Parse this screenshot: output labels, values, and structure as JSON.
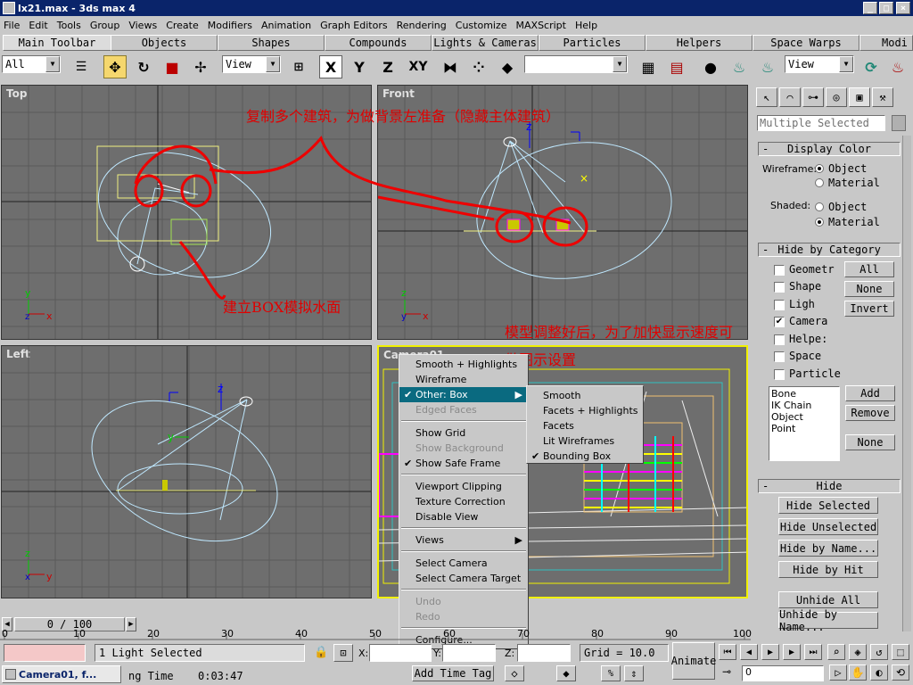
{
  "window": {
    "title": "lx21.max - 3ds max 4",
    "controls": [
      "_",
      "□",
      "×"
    ]
  },
  "menubar": [
    "File",
    "Edit",
    "Tools",
    "Group",
    "Views",
    "Create",
    "Modifiers",
    "Animation",
    "Graph Editors",
    "Rendering",
    "Customize",
    "MAXScript",
    "Help"
  ],
  "tabs": [
    "Main Toolbar",
    "Objects",
    "Shapes",
    "Compounds",
    "Lights & Cameras",
    "Particles",
    "Helpers",
    "Space Warps",
    "Modi"
  ],
  "toolbar": {
    "selection_filter": "All",
    "ref_coord": "View",
    "ref_coord2": "View",
    "axes": [
      "X",
      "Y",
      "Z",
      "XY"
    ],
    "named_selection": ""
  },
  "viewports": {
    "top": {
      "label": "Top"
    },
    "front": {
      "label": "Front"
    },
    "left": {
      "label": "Left"
    },
    "camera": {
      "label": "Camera01"
    }
  },
  "annotations": {
    "a1": "复制多个建筑，为做背景左准备（隐藏主体建筑）",
    "a2": "建立BOX模拟水面",
    "a3": "模型调整好后，为了加快显示速度可",
    "a4": "做图示设置"
  },
  "context_menu": {
    "items": [
      {
        "label": "Smooth + Highlights",
        "state": "normal"
      },
      {
        "label": "Wireframe",
        "state": "normal"
      },
      {
        "label": "Other: Box",
        "state": "selected"
      },
      {
        "label": "Edged Faces",
        "state": "disabled"
      },
      {
        "label": "Show Grid",
        "state": "normal"
      },
      {
        "label": "Show Background",
        "state": "disabled"
      },
      {
        "label": "Show Safe Frame",
        "state": "checked"
      },
      {
        "label": "Viewport Clipping",
        "state": "normal"
      },
      {
        "label": "Texture Correction",
        "state": "normal"
      },
      {
        "label": "Disable View",
        "state": "normal"
      },
      {
        "label": "Views",
        "state": "submenu"
      },
      {
        "label": "Select Camera",
        "state": "normal"
      },
      {
        "label": "Select Camera Target",
        "state": "normal"
      },
      {
        "label": "Undo",
        "state": "disabled"
      },
      {
        "label": "Redo",
        "state": "disabled"
      },
      {
        "label": "Configure...",
        "state": "normal"
      }
    ],
    "submenu": [
      {
        "label": "Smooth",
        "checked": false
      },
      {
        "label": "Facets + Highlights",
        "checked": false
      },
      {
        "label": "Facets",
        "checked": false
      },
      {
        "label": "Lit Wireframes",
        "checked": false
      },
      {
        "label": "Bounding Box",
        "checked": true
      }
    ]
  },
  "command_panel": {
    "selection_name": "Multiple Selected",
    "display_color": {
      "title": "Display Color",
      "wireframe_label": "Wireframe:",
      "shaded_label": "Shaded:",
      "opt_object": "Object",
      "opt_material": "Material",
      "wireframe_value": "Object",
      "shaded_value": "Material"
    },
    "hide_by_category": {
      "title": "Hide by Category",
      "items": [
        {
          "label": "Geometr",
          "checked": false
        },
        {
          "label": "Shape",
          "checked": false
        },
        {
          "label": "Ligh",
          "checked": false
        },
        {
          "label": "Camera",
          "checked": true
        },
        {
          "label": "Helpe:",
          "checked": false
        },
        {
          "label": "Space",
          "checked": false
        },
        {
          "label": "Particle",
          "checked": false
        }
      ],
      "buttons": [
        "All",
        "None",
        "Invert"
      ],
      "list": [
        "Bone",
        "IK Chain Object",
        "Point"
      ],
      "add": "Add",
      "remove": "Remove",
      "none": "None"
    },
    "hide": {
      "title": "Hide",
      "buttons": [
        "Hide Selected",
        "Hide Unselected",
        "Hide by Name...",
        "Hide by Hit",
        "Unhide All",
        "Unhide by Name..."
      ]
    }
  },
  "timeline": {
    "frame": "0 / 100",
    "ticks": [
      "0",
      "10",
      "20",
      "30",
      "40",
      "50",
      "60",
      "70",
      "80",
      "90",
      "100"
    ]
  },
  "status": {
    "selected": "1 Light Selected",
    "x_label": "X:",
    "y_label": "Y:",
    "z_label": "Z:",
    "grid": "Grid = 10.0",
    "animate": "Animate",
    "frame_value": "0",
    "timetag": "Add Time Tag",
    "prompt_label": "ng Time",
    "time": "0:03:47"
  },
  "taskbar": {
    "item": "Camera01, f..."
  },
  "colors": {
    "title_bg": "#0a246a",
    "viewport_bg": "#6e6e6e",
    "menu_selected": "#0a6a80",
    "annotation": "#e00000",
    "active_border": "#f0f000"
  }
}
